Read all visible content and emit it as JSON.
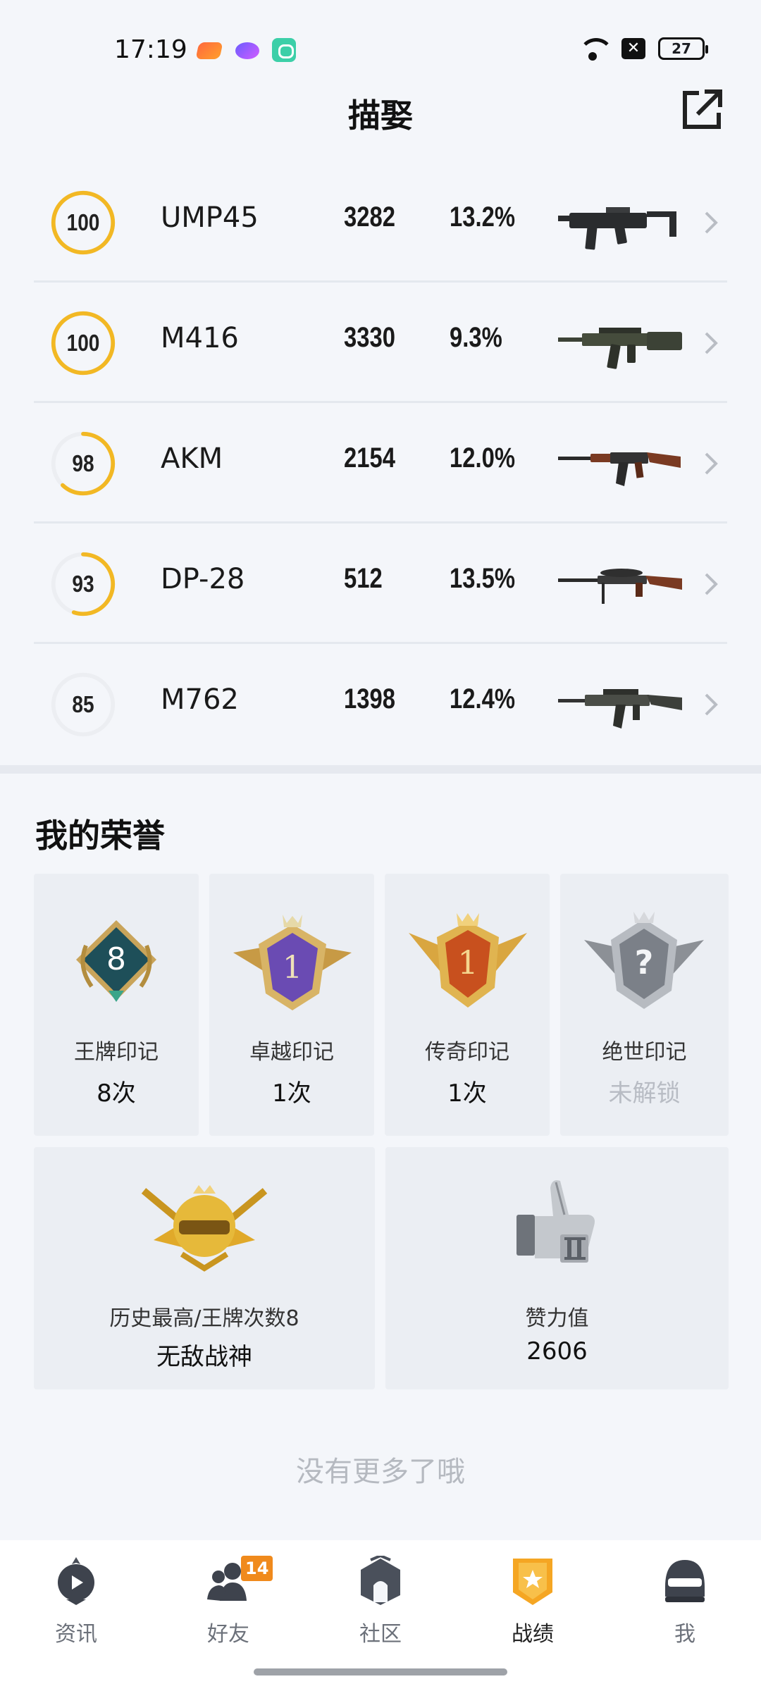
{
  "status_bar": {
    "time": "17:19",
    "battery": "27"
  },
  "header": {
    "title": "描娶"
  },
  "weapons": [
    {
      "score": "100",
      "score_fraction": 1.0,
      "name": "UMP45",
      "kills": "3282",
      "rate": "13.2%",
      "ring_color": "#f2b824"
    },
    {
      "score": "100",
      "score_fraction": 1.0,
      "name": "M416",
      "kills": "3330",
      "rate": "9.3%",
      "ring_color": "#f2b824"
    },
    {
      "score": "98",
      "score_fraction": 0.62,
      "name": "AKM",
      "kills": "2154",
      "rate": "12.0%",
      "ring_color": "#f2b824"
    },
    {
      "score": "93",
      "score_fraction": 0.55,
      "name": "DP-28",
      "kills": "512",
      "rate": "13.5%",
      "ring_color": "#f2b824"
    },
    {
      "score": "85",
      "score_fraction": 0.0,
      "name": "M762",
      "kills": "1398",
      "rate": "12.4%",
      "ring_color": "#f2b824"
    }
  ],
  "honor": {
    "title": "我的荣誉",
    "marks": [
      {
        "label": "王牌印记",
        "value": "8次",
        "badge_text": "8"
      },
      {
        "label": "卓越印记",
        "value": "1次",
        "badge_text": "1"
      },
      {
        "label": "传奇印记",
        "value": "1次",
        "badge_text": "1"
      },
      {
        "label": "绝世印记",
        "value": "未解锁",
        "badge_text": "?"
      }
    ],
    "highest": {
      "label": "历史最高/王牌次数8",
      "value": "无敌战神"
    },
    "likes": {
      "label": "赞力值",
      "value": "2606"
    }
  },
  "footer_text": "没有更多了哦",
  "bottom_nav": {
    "items": [
      {
        "label": "资讯",
        "icon": "news-icon"
      },
      {
        "label": "好友",
        "icon": "friends-icon",
        "badge": "14"
      },
      {
        "label": "社区",
        "icon": "community-icon"
      },
      {
        "label": "战绩",
        "icon": "record-icon",
        "active": true
      },
      {
        "label": "我",
        "icon": "profile-helmet-icon"
      }
    ]
  },
  "colors": {
    "accent": "#f2b824",
    "nav_badge": "#f08a1c",
    "background": "#f4f6fa"
  }
}
